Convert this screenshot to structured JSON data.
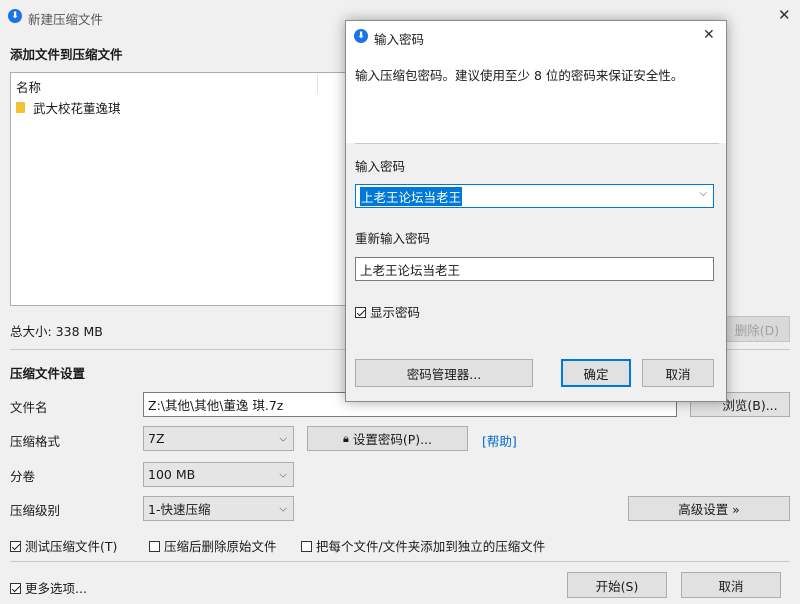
{
  "main_window": {
    "title": "新建压缩文件",
    "add_section_heading": "添加文件到压缩文件",
    "file_list": {
      "column_name": "名称",
      "items": [
        {
          "name": "武大校花董逸琪",
          "icon": "folder-icon"
        }
      ]
    },
    "total_size": "总大小: 338 MB",
    "delete_button": "删除(D)",
    "settings_heading": "压缩文件设置",
    "filename_label": "文件名",
    "filename_value": "Z:\\其他\\其他\\董逸 琪.7z",
    "browse_button": "浏览(B)...",
    "format_label": "压缩格式",
    "format_value": "7Z",
    "set_password_button": "设置密码(P)...",
    "help_link": "[帮助]",
    "split_label": "分卷",
    "split_value": "100 MB",
    "level_label": "压缩级别",
    "level_value": "1-快速压缩",
    "advanced_button": "高级设置 »",
    "test_checkbox": {
      "label": "测试压缩文件(T)",
      "checked": true
    },
    "delete_original_checkbox": {
      "label": "压缩后删除原始文件",
      "checked": false
    },
    "separate_checkbox": {
      "label": "把每个文件/文件夹添加到独立的压缩文件",
      "checked": false
    },
    "more_options_checkbox": {
      "label": "更多选项...",
      "checked": true
    },
    "start_button": "开始(S)",
    "cancel_button": "取消"
  },
  "dialog": {
    "title": "输入密码",
    "description": "输入压缩包密码。建议使用至少 8 位的密码来保证安全性。",
    "password_label": "输入密码",
    "password_value": "上老王论坛当老王",
    "reenter_label": "重新输入密码",
    "reenter_value": "上老王论坛当老王",
    "show_password": {
      "label": "显示密码",
      "checked": true
    },
    "manager_button": "密码管理器...",
    "ok_button": "确定",
    "cancel_button": "取消"
  },
  "colors": {
    "accent": "#1a73e8",
    "link": "#0066cc",
    "selection": "#0078d7"
  }
}
